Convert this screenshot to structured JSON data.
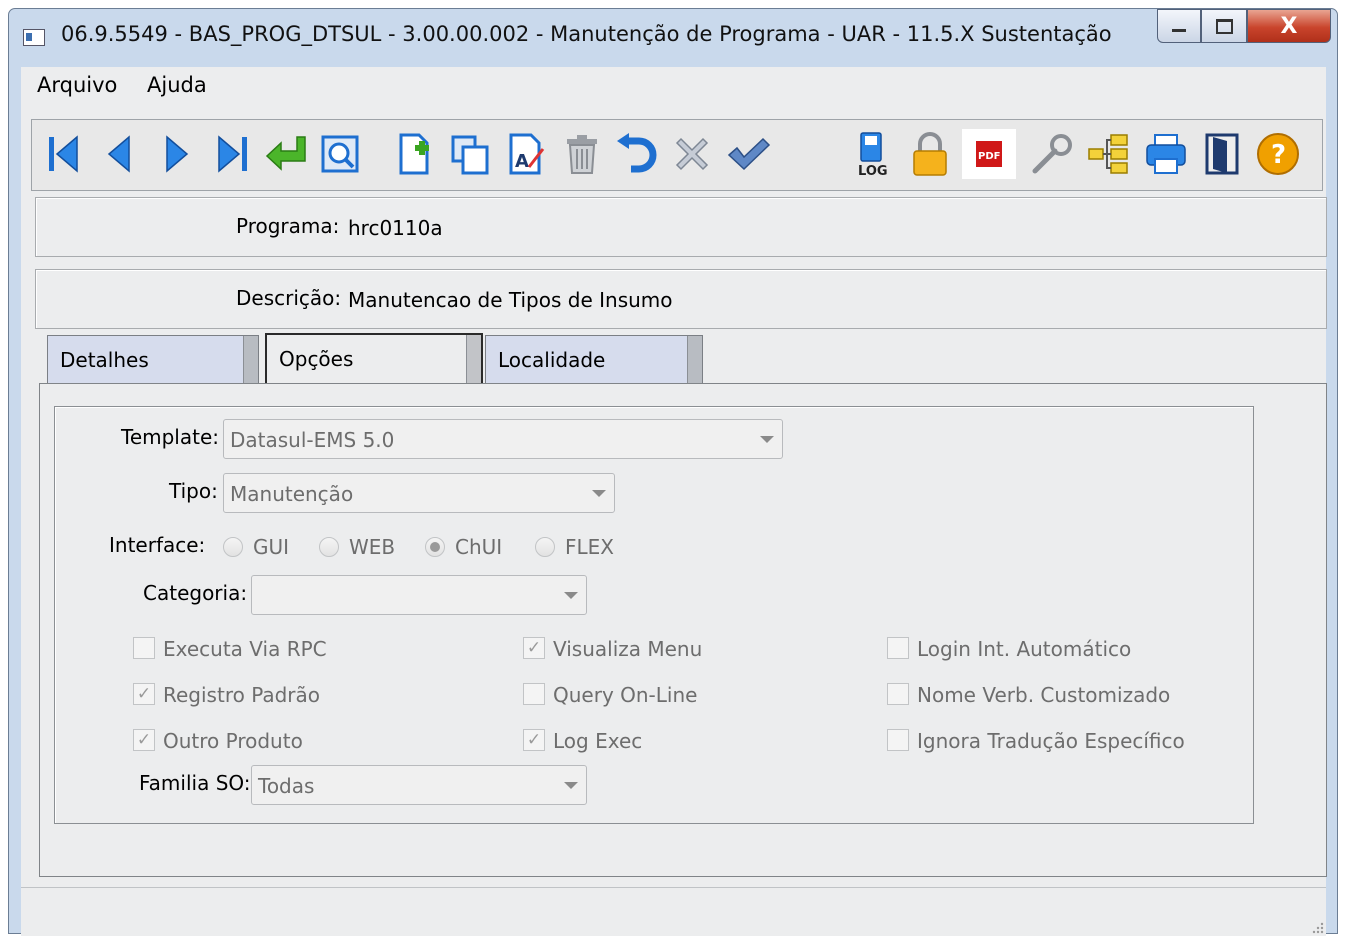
{
  "window": {
    "title": "06.9.5549 - BAS_PROG_DTSUL - 3.00.00.002 - Manutenção de Programa - UAR - 11.5.X Sustentação",
    "controls": [
      "minimize-icon",
      "maximize-icon",
      "close-icon"
    ],
    "close_glyph": "X"
  },
  "menubar": {
    "items": [
      {
        "label": "Arquivo"
      },
      {
        "label": "Ajuda"
      }
    ]
  },
  "toolbar": {
    "buttons": [
      "first-record-icon",
      "previous-record-icon",
      "next-record-icon",
      "last-record-icon",
      "go-to-icon",
      "search-icon",
      "new-document-icon",
      "copy-icon",
      "edit-icon",
      "delete-icon",
      "undo-icon",
      "cancel-icon",
      "confirm-icon",
      "log-icon",
      "lock-icon",
      "pdf-icon",
      "wrench-icon",
      "tree-icon",
      "print-icon",
      "exit-icon",
      "help-icon"
    ],
    "log_text": "LOG",
    "pdf_text": "PDF",
    "help_glyph": "?"
  },
  "programa": {
    "label": "Programa:",
    "value": "hrc0110a"
  },
  "descricao": {
    "label": "Descrição:",
    "value": "Manutencao de Tipos de Insumo"
  },
  "tabs": [
    {
      "label": "Detalhes",
      "active": false
    },
    {
      "label": "Opções",
      "active": true
    },
    {
      "label": "Localidade",
      "active": false
    }
  ],
  "form": {
    "template": {
      "label": "Template:",
      "value": "Datasul-EMS 5.0"
    },
    "tipo": {
      "label": "Tipo:",
      "value": "Manutenção"
    },
    "interface": {
      "label": "Interface:",
      "options": [
        {
          "label": "GUI",
          "selected": false
        },
        {
          "label": "WEB",
          "selected": false
        },
        {
          "label": "ChUI",
          "selected": true
        },
        {
          "label": "FLEX",
          "selected": false
        }
      ]
    },
    "categoria": {
      "label": "Categoria:",
      "value": ""
    },
    "checkboxes": [
      {
        "label": "Executa Via RPC",
        "checked": false
      },
      {
        "label": "Visualiza Menu",
        "checked": true
      },
      {
        "label": "Login Int. Automático",
        "checked": false
      },
      {
        "label": "Registro Padrão",
        "checked": true
      },
      {
        "label": "Query On-Line",
        "checked": false
      },
      {
        "label": "Nome Verb. Customizado",
        "checked": false
      },
      {
        "label": "Outro Produto",
        "checked": true
      },
      {
        "label": "Log Exec",
        "checked": true
      },
      {
        "label": "Ignora Tradução Específico",
        "checked": false
      }
    ],
    "check_glyph": "✓",
    "familia_so": {
      "label": "Familia SO:",
      "value": "Todas"
    }
  },
  "colors": {
    "accent_blue": "#1e6fd0",
    "green_arrow": "#3aa521",
    "help_orange": "#f0a000",
    "pdf_red": "#d01818"
  }
}
